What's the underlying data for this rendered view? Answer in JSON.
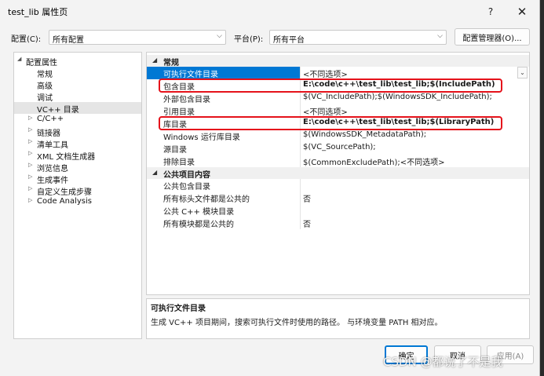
{
  "window": {
    "title": "test_lib 属性页",
    "help_glyph": "?",
    "close_glyph": "✕"
  },
  "config_bar": {
    "config_label": "配置(C):",
    "config_value": "所有配置",
    "platform_label": "平台(P):",
    "platform_value": "所有平台",
    "manager_button": "配置管理器(O)..."
  },
  "tree": {
    "items": [
      {
        "label": "配置属性",
        "arrow": "◢"
      },
      {
        "label": "常规"
      },
      {
        "label": "高级"
      },
      {
        "label": "调试"
      },
      {
        "label": "VC++ 目录"
      },
      {
        "label": "C/C++",
        "arrow": "▷"
      },
      {
        "label": "链接器",
        "arrow": "▷"
      },
      {
        "label": "清单工具",
        "arrow": "▷"
      },
      {
        "label": "XML 文档生成器",
        "arrow": "▷"
      },
      {
        "label": "浏览信息",
        "arrow": "▷"
      },
      {
        "label": "生成事件",
        "arrow": "▷"
      },
      {
        "label": "自定义生成步骤",
        "arrow": "▷"
      },
      {
        "label": "Code Analysis",
        "arrow": "▷"
      }
    ]
  },
  "grid": {
    "categories": [
      {
        "label": "常规",
        "rows": [
          {
            "name": "可执行文件目录",
            "value": "<不同选项>"
          },
          {
            "name": "包含目录",
            "value": "E:\\code\\c++\\test_lib\\test_lib;$(IncludePath)"
          },
          {
            "name": "外部包含目录",
            "value": "$(VC_IncludePath);$(WindowsSDK_IncludePath);"
          },
          {
            "name": "引用目录",
            "value": "<不同选项>"
          },
          {
            "name": "库目录",
            "value": "E:\\code\\c++\\test_lib\\test_lib;$(LibraryPath)"
          },
          {
            "name": "Windows 运行库目录",
            "value": "$(WindowsSDK_MetadataPath);"
          },
          {
            "name": "源目录",
            "value": "$(VC_SourcePath);"
          },
          {
            "name": "排除目录",
            "value": "$(CommonExcludePath);<不同选项>"
          }
        ]
      },
      {
        "label": "公共项目内容",
        "rows": [
          {
            "name": "公共包含目录",
            "value": ""
          },
          {
            "name": "所有标头文件都是公共的",
            "value": "否"
          },
          {
            "name": "公共 C++ 模块目录",
            "value": ""
          },
          {
            "name": "所有模块都是公共的",
            "value": "否"
          }
        ]
      }
    ],
    "dropdown_glyph": "⌄"
  },
  "description": {
    "title": "可执行文件目录",
    "text": "生成 VC++ 项目期间，搜索可执行文件时使用的路径。 与环境变量 PATH 相对应。"
  },
  "footer": {
    "ok": "确定",
    "cancel": "取消",
    "apply": "应用(A)"
  },
  "watermark": "CSDN @都说了不是我",
  "colors": {
    "selection": "#0078d4",
    "highlight_box": "#e5121b",
    "window_bg": "#f3f3f3"
  }
}
